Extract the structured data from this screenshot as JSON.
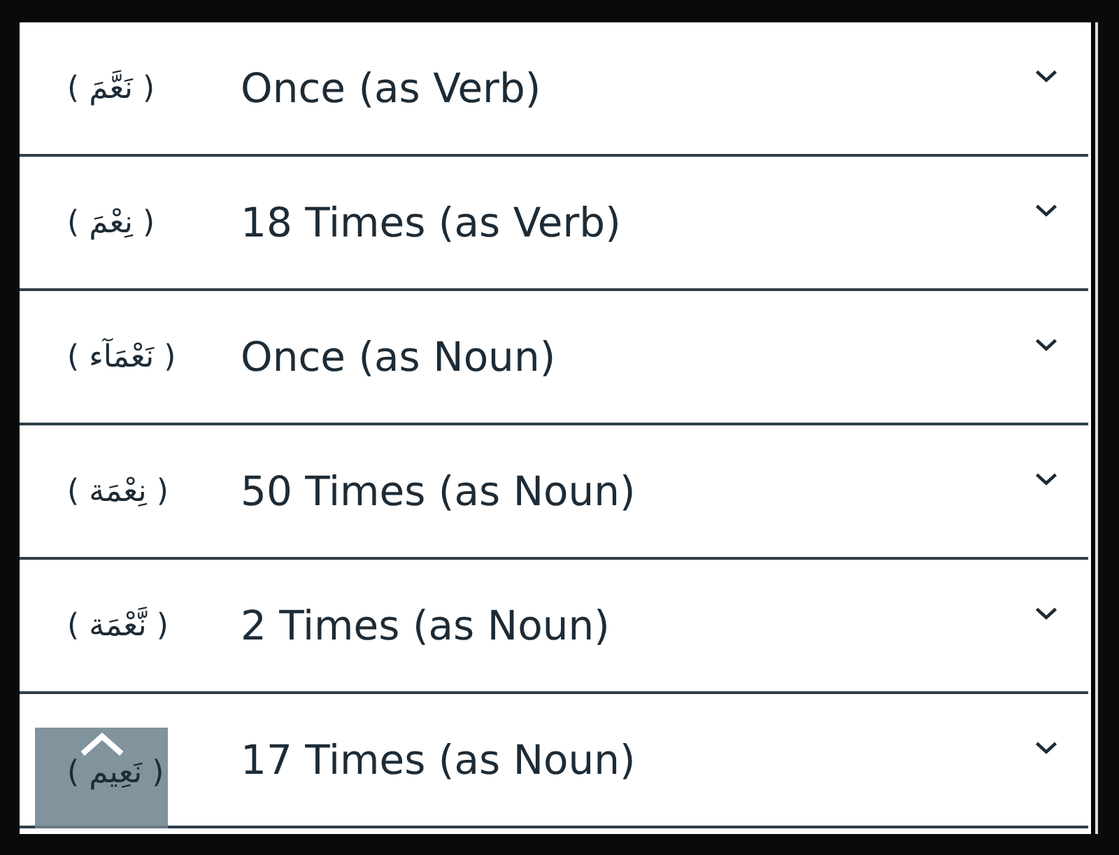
{
  "rows": [
    {
      "arabic": "( نَعَّمَ )",
      "label": "Once (as Verb)",
      "expanded": false
    },
    {
      "arabic": "( نِعْمَ )",
      "label": "18 Times (as Verb)",
      "expanded": false
    },
    {
      "arabic": "( نَعْمَآء )",
      "label": "Once (as Noun)",
      "expanded": false
    },
    {
      "arabic": "( نِعْمَة )",
      "label": "50 Times (as Noun)",
      "expanded": false
    },
    {
      "arabic": "( نَّعْمَة )",
      "label": "2 Times (as Noun)",
      "expanded": false
    },
    {
      "arabic": "( نَعِيم )",
      "label": "17 Times (as Noun)",
      "expanded": false
    }
  ]
}
